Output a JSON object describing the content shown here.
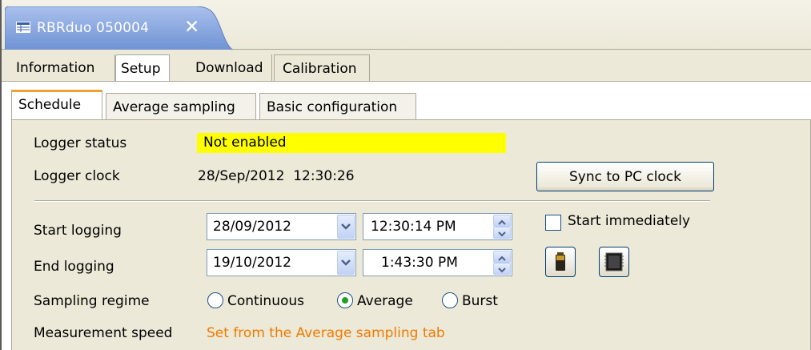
{
  "editor_tab": {
    "title": "RBRduo 050004",
    "close_glyph": "✕"
  },
  "top_tabs": [
    "Information",
    "Setup",
    "Download",
    "Calibration"
  ],
  "sub_tabs": [
    "Schedule",
    "Average sampling",
    "Basic configuration"
  ],
  "logger_status": {
    "label": "Logger status",
    "value": "Not enabled",
    "highlight": "#ffff00"
  },
  "logger_clock": {
    "label": "Logger clock",
    "value": "28/Sep/2012  12:30:26",
    "sync_button": "Sync to PC clock"
  },
  "start_logging": {
    "label": "Start logging",
    "date": "28/09/2012",
    "time": "12:30:14 PM",
    "immediately_label": "Start immediately",
    "immediately_checked": false
  },
  "end_logging": {
    "label": "End logging",
    "date": "19/10/2012",
    "time": "1:43:30 PM"
  },
  "end_buttons": [
    "battery-icon",
    "memory-icon"
  ],
  "sampling_regime": {
    "label": "Sampling regime",
    "options": [
      "Continuous",
      "Average",
      "Burst"
    ],
    "selected": "Average"
  },
  "measurement_speed": {
    "label": "Measurement speed",
    "note": "Set from the Average sampling tab",
    "note_color": "#f07a00"
  },
  "colors": {
    "editor_tab": "#7a9bd8",
    "active_subtab_accent": "#f0a030"
  }
}
